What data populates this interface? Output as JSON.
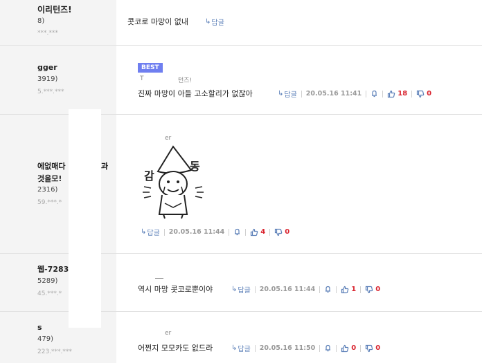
{
  "comments": [
    {
      "nickname": "이리턴즈!",
      "count": "8)",
      "ip": "***.***",
      "text": "콧코로 마망이 없내",
      "reply_label": "답글"
    },
    {
      "nickname": "gger",
      "count": "3919)",
      "ip": "5.***.***",
      "best_label": "BEST",
      "quote_author": "T",
      "quote_author_tail": "턴즈!",
      "text": "진짜 마망이 아들 고소할리가 없잖아",
      "reply_label": "답글",
      "date": "20.05.16 11:41",
      "up": "18",
      "down": "0"
    },
    {
      "nickname": "에없매다",
      "nickname_tail": "과",
      "nickname2": "것을모!",
      "count": "2316)",
      "ip": "59.***.*",
      "sticker_author": "er",
      "sticker_alt": "감동",
      "sticker_text_left": "감",
      "sticker_text_right": "동",
      "reply_label": "답글",
      "date": "20.05.16 11:44",
      "up": "4",
      "down": "0"
    },
    {
      "nickname": "웹-7283",
      "count": "5289)",
      "ip": "45.***.*",
      "text": "역시 마망 콧코로뿐이야",
      "reply_label": "답글",
      "date": "20.05.16 11:44",
      "up": "1",
      "down": "0"
    },
    {
      "nickname": "s",
      "count": "479)",
      "ip": "223.***.***",
      "quote_author": "er",
      "text": "어쩐지 모모카도 없드라",
      "reply_label": "답글",
      "date": "20.05.16 11:50",
      "up": "0",
      "down": "0"
    }
  ],
  "colors": {
    "accent": "#5b7fb8",
    "vote_red": "#d9232e",
    "best_bg": "#6f7ff0",
    "left_bg": "#f4f4f4"
  },
  "icons": [
    "reply-arrow-icon",
    "report-bell-icon",
    "thumbs-up-icon",
    "thumbs-down-icon"
  ]
}
